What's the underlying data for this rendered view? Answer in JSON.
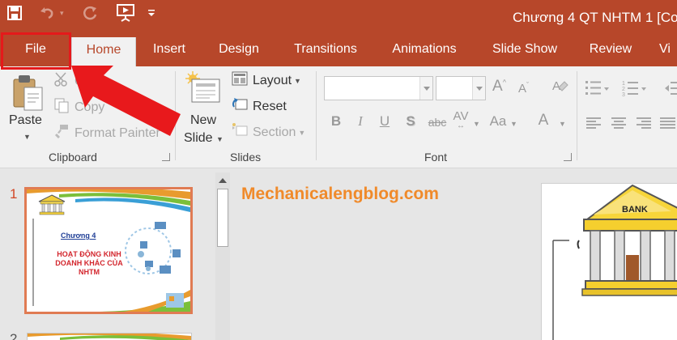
{
  "window": {
    "title": "Chương 4 QT NHTM 1 [Co"
  },
  "quick_access": {
    "icons": [
      "save-icon",
      "undo-icon",
      "redo-icon",
      "start-from-beginning-icon",
      "customize-quick-access-icon"
    ]
  },
  "tabs": [
    {
      "label": "File"
    },
    {
      "label": "Home"
    },
    {
      "label": "Insert"
    },
    {
      "label": "Design"
    },
    {
      "label": "Transitions"
    },
    {
      "label": "Animations"
    },
    {
      "label": "Slide Show"
    },
    {
      "label": "Review"
    },
    {
      "label": "Vi"
    }
  ],
  "active_tab": "Home",
  "ribbon": {
    "clipboard": {
      "group_label": "Clipboard",
      "paste_label": "Paste",
      "cut_label": "Cu",
      "copy_label": "Copy",
      "format_painter_label": "Format Painter"
    },
    "slides": {
      "group_label": "Slides",
      "new_slide_line1": "New",
      "new_slide_line2": "Slide",
      "layout_label": "Layout",
      "reset_label": "Reset",
      "section_label": "Section"
    },
    "font": {
      "group_label": "Font",
      "font_name_value": "",
      "font_size_value": "",
      "format_buttons": [
        "B",
        "I",
        "U",
        "S",
        "abc",
        "AV",
        "Aa",
        "A"
      ]
    }
  },
  "thumbnails": [
    {
      "number": "1",
      "chapter": "Chương 4",
      "title_line1": "HOẠT ĐỘNG KINH",
      "title_line2": "DOANH KHÁC CỦA",
      "title_line3": "NHTM"
    },
    {
      "number": "2"
    }
  ],
  "watermark": "Mechanicalengblog.com",
  "slide": {
    "bank_sign": "BANK"
  },
  "colors": {
    "accent": "#b7472a",
    "highlight_box": "#e5191b",
    "arrow": "#e8191c",
    "watermark": "#f08a2a",
    "thumb_border": "#e07b53"
  }
}
